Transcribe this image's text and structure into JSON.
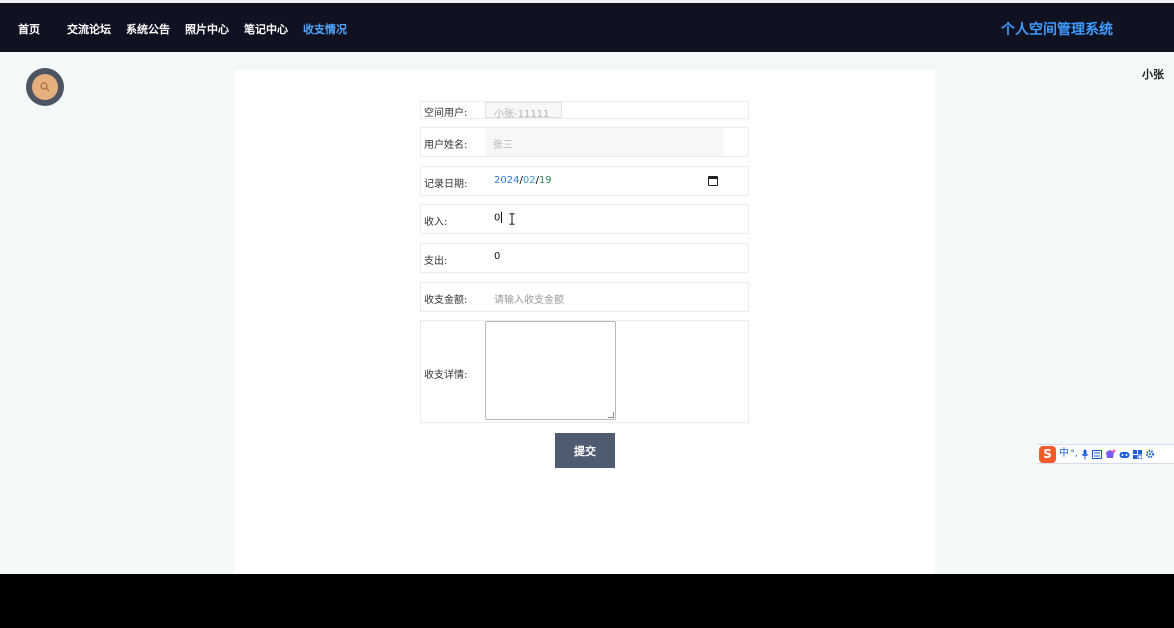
{
  "nav": {
    "items": [
      {
        "label": "首页"
      },
      {
        "label": "交流论坛"
      },
      {
        "label": "系统公告"
      },
      {
        "label": "照片中心"
      },
      {
        "label": "笔记中心"
      },
      {
        "label": "收支情况"
      }
    ],
    "active_index": 5,
    "brand": "个人空间管理系统"
  },
  "user": {
    "name": "小张",
    "avatar_icon": "search-icon"
  },
  "form": {
    "space_user": {
      "label": "空间用户:",
      "value": "小张-11111"
    },
    "user_name": {
      "label": "用户姓名:",
      "value": "张三"
    },
    "record_date": {
      "label": "记录日期:",
      "year": "2024",
      "month": "02",
      "day": "19",
      "sep": "/"
    },
    "income": {
      "label": "收入:",
      "value": "0"
    },
    "expense": {
      "label": "支出:",
      "value": "0"
    },
    "amount": {
      "label": "收支金额:",
      "placeholder": "请输入收支金额"
    },
    "detail": {
      "label": "收支详情:",
      "value": ""
    },
    "submit_label": "提交"
  },
  "ime": {
    "logo": "S",
    "icons": [
      "中",
      "°,",
      "mic-icon",
      "keyboard-icon",
      "skin-icon",
      "gamepad-icon",
      "grid-icon",
      "gear-icon"
    ]
  },
  "colors": {
    "navbar_bg": "#101222",
    "active_nav": "#4fa6ff",
    "brand": "#3f9bff",
    "submit_bg": "#4e5b70",
    "content_bg": "#f3f8f8"
  }
}
